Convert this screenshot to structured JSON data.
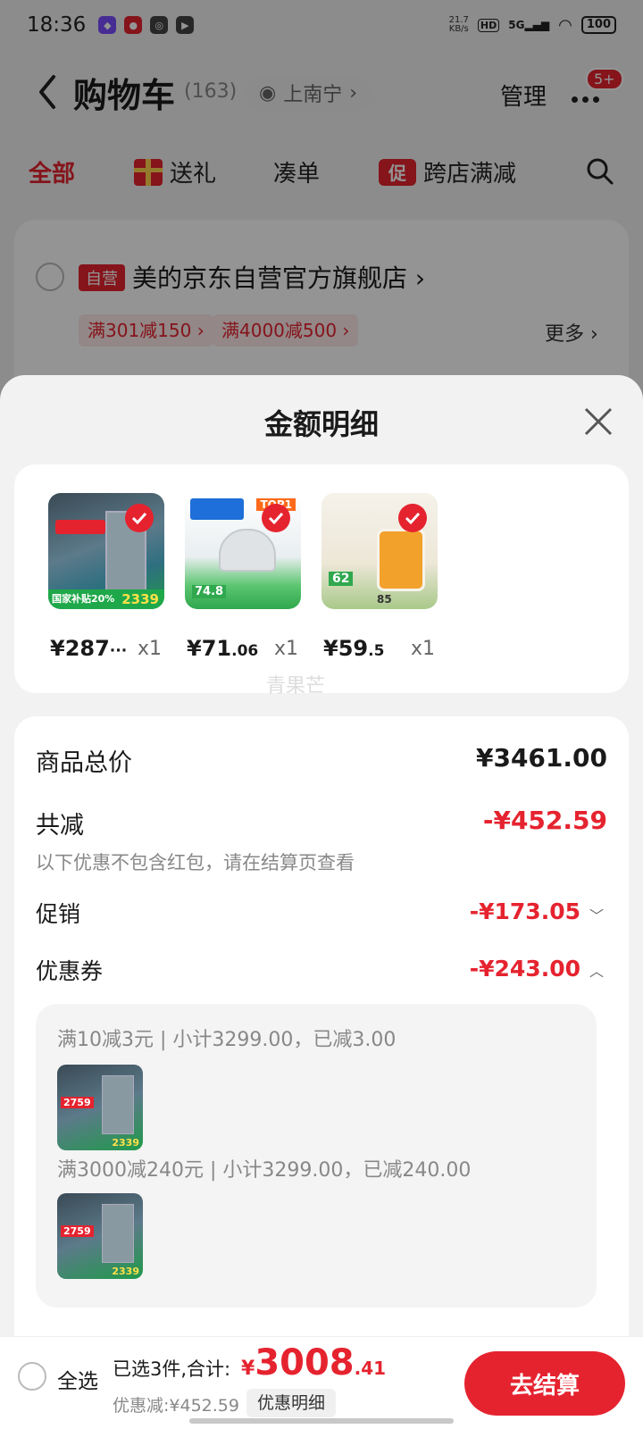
{
  "status_bar": {
    "time": "18:36",
    "net_speed_value": "21.7",
    "net_speed_unit": "KB/s",
    "hd": "HD",
    "signal": "5G",
    "battery": "100"
  },
  "nav": {
    "title": "购物车",
    "count": "(163)",
    "location": "上南宁",
    "manage": "管理",
    "more_badge": "5+"
  },
  "tabs": {
    "all": "全部",
    "gift": "送礼",
    "bundle": "凑单",
    "cross_store_icon": "促",
    "cross_store": "跨店满减"
  },
  "store": {
    "self_tag": "自营",
    "name": "美的京东自营官方旗舰店",
    "coupons": [
      "满301减150 ›",
      "满4000减500 ›"
    ],
    "more": "更多 ›"
  },
  "sheet": {
    "title": "金额明细",
    "products": [
      {
        "price_main": "¥287",
        "price_ellipsis": "···",
        "price_cents": "",
        "qty": "x1",
        "img_text": "国家补贴20%",
        "img_price": "2339"
      },
      {
        "price_main": "¥71",
        "price_ellipsis": "",
        "price_cents": ".06",
        "qty": "x1",
        "img_text": "TOP1",
        "img_price": "74.8"
      },
      {
        "price_main": "¥59",
        "price_ellipsis": "",
        "price_cents": ".5",
        "qty": "x1",
        "img_text": "62",
        "img_price": "85"
      }
    ],
    "watermark": "青果芒",
    "total_label": "商品总价",
    "total_value": "¥3461.00",
    "reduce_label": "共减",
    "reduce_value": "-¥452.59",
    "reduce_note": "以下优惠不包含红包，请在结算页查看",
    "promo_label": "促销",
    "promo_value": "-¥173.05",
    "coupon_label": "优惠券",
    "coupon_value": "-¥243.00",
    "coupon_lines": [
      "满10减3元 | 小计3299.00，已减3.00",
      "满3000减240元 | 小计3299.00，已减240.00"
    ],
    "thumb_price": "2759",
    "thumb_price2": "2339"
  },
  "bottom": {
    "select_all": "全选",
    "selected": "已选3件,合计:",
    "currency": "¥",
    "total_int": "3008",
    "total_dec": ".41",
    "saved": "优惠减:¥452.59",
    "detail_btn": "优惠明细",
    "checkout": "去结算"
  },
  "colors": {
    "accent": "#e5232f",
    "background": "#f2f2f2"
  }
}
